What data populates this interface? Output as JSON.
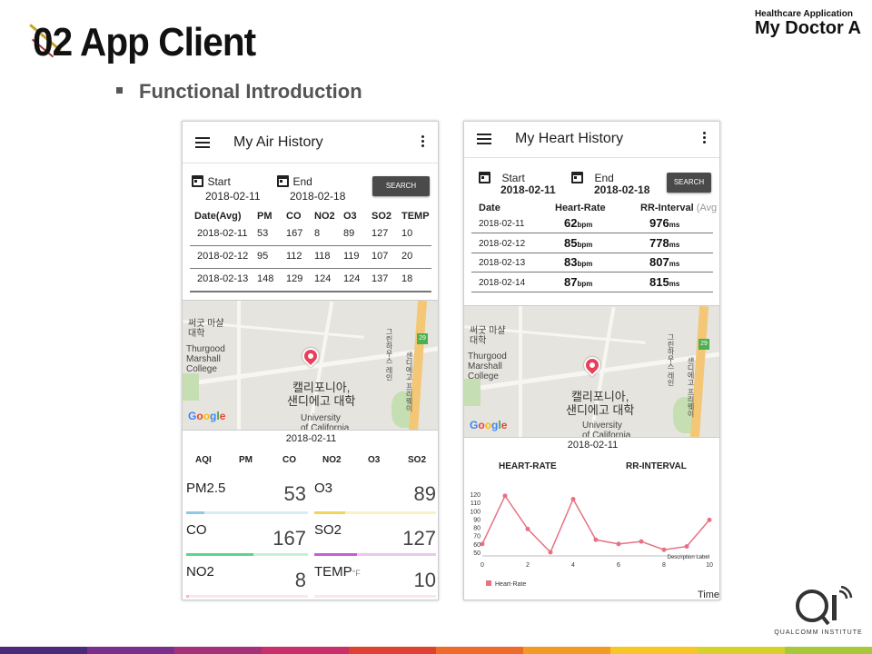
{
  "slide": {
    "title": "02 App Client",
    "brand_small": "Healthcare Application",
    "brand_big": "My Doctor A",
    "bullet": "Functional Introduction",
    "institute": "QUALCOMM INSTITUTE"
  },
  "colors": {
    "stripe": [
      "#4b2a7a",
      "#7a2f8c",
      "#a4317a",
      "#c7306a",
      "#e0402f",
      "#ee6a2a",
      "#f39a25",
      "#f7c624",
      "#d6d12a",
      "#a5c93a"
    ]
  },
  "air": {
    "app_title": "My Air History",
    "start_label": "Start",
    "end_label": "End",
    "start_date": "2018-02-11",
    "end_date": "2018-02-18",
    "search_label": "SEARCH",
    "headers": [
      "Date(Avg)",
      "PM",
      "CO",
      "NO2",
      "O3",
      "SO2",
      "TEMP"
    ],
    "rows": [
      [
        "2018-02-11",
        "53",
        "167",
        "8",
        "89",
        "127",
        "10"
      ],
      [
        "2018-02-12",
        "95",
        "112",
        "118",
        "119",
        "107",
        "20"
      ],
      [
        "2018-02-13",
        "148",
        "129",
        "124",
        "124",
        "137",
        "18"
      ]
    ],
    "map": {
      "label_1": "써굿 마샬\n대학",
      "label_2": "Thurgood\nMarshall\nCollege",
      "label_3": "캘리포니아,\n샌디에고 대학",
      "label_4": "University\nof California",
      "road_label": "그린하우스 레인",
      "road_label_2": "샌디에고 프리웨이",
      "shield": "29",
      "google": "Google"
    },
    "selected_date": "2018-02-11",
    "aqi_headers": [
      "AQI",
      "PM",
      "CO",
      "NO2",
      "O3",
      "SO2"
    ],
    "tiles": [
      {
        "label": "PM2.5",
        "unit": "",
        "value": "53",
        "color": "#8fc9e6",
        "fill": 0.15
      },
      {
        "label": "O3",
        "unit": "",
        "value": "89",
        "color": "#f2d35b",
        "fill": 0.25
      },
      {
        "label": "CO",
        "unit": "",
        "value": "167",
        "color": "#58d68d",
        "fill": 0.55
      },
      {
        "label": "SO2",
        "unit": "",
        "value": "127",
        "color": "#c65fd4",
        "fill": 0.35
      },
      {
        "label": "NO2",
        "unit": "",
        "value": "8",
        "color": "#f3b6c4",
        "fill": 0.02
      },
      {
        "label": "TEMP",
        "unit": "°F",
        "value": "10",
        "color": "#f3b6c4",
        "fill": 0.0
      }
    ]
  },
  "heart": {
    "app_title": "My Heart History",
    "start_label": "Start",
    "end_label": "End",
    "start_date": "2018-02-11",
    "end_date": "2018-02-18",
    "search_label": "SEARCH",
    "headers": {
      "date": "Date",
      "hr": "Heart-Rate",
      "rr": "RR-Interval",
      "rr_sub": "(Avg"
    },
    "hr_unit": "bpm",
    "rr_unit": "ms",
    "rows": [
      {
        "date": "2018-02-11",
        "hr": "62",
        "rr": "976"
      },
      {
        "date": "2018-02-12",
        "hr": "85",
        "rr": "778"
      },
      {
        "date": "2018-02-13",
        "hr": "83",
        "rr": "807"
      },
      {
        "date": "2018-02-14",
        "hr": "87",
        "rr": "815"
      }
    ],
    "map": {
      "label_1": "써굿 마샬\n대학",
      "label_2": "Thurgood\nMarshall\nCollege",
      "label_3": "캘리포니아,\n샌디에고 대학",
      "label_4": "University\nof California",
      "road_label": "그린하우스 레인",
      "road_label_2": "샌디에고 프리웨이",
      "shield": "29",
      "google": "Google"
    },
    "selected_date": "2018-02-11",
    "tab_hr": "HEART-RATE",
    "tab_rr": "RR-INTERVAL",
    "time_label": "Time"
  },
  "chart_data": {
    "type": "line",
    "x": [
      0,
      1,
      2,
      3,
      4,
      5,
      6,
      7,
      8,
      9,
      10
    ],
    "series": [
      {
        "name": "Heart-Rate",
        "values": [
          60,
          118,
          78,
          50,
          114,
          65,
          60,
          63,
          53,
          57,
          89
        ],
        "color": "#e57383"
      }
    ],
    "xticks": [
      "0",
      "2",
      "4",
      "6",
      "8",
      "10"
    ],
    "yticks": [
      "50",
      "60",
      "70",
      "80",
      "90",
      "100",
      "110",
      "120"
    ],
    "xlim": [
      0,
      10
    ],
    "ylim": [
      50,
      120
    ],
    "description_label": "Description Label",
    "legend_position": "bottom-left"
  }
}
